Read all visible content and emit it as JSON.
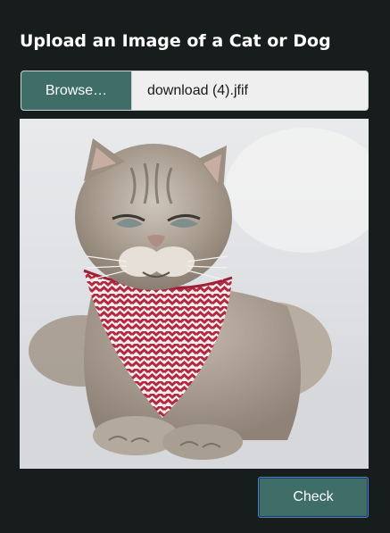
{
  "header": {
    "title": "Upload an Image of a Cat or Dog"
  },
  "upload": {
    "browse_label": "Browse…",
    "file_name": "download (4).jfif"
  },
  "preview": {
    "subject": "cat-wearing-zigzag-bandana"
  },
  "actions": {
    "check_label": "Check"
  },
  "colors": {
    "background": "#171d1c",
    "accent": "#3f6e69",
    "button_border": "#4b83c4"
  }
}
